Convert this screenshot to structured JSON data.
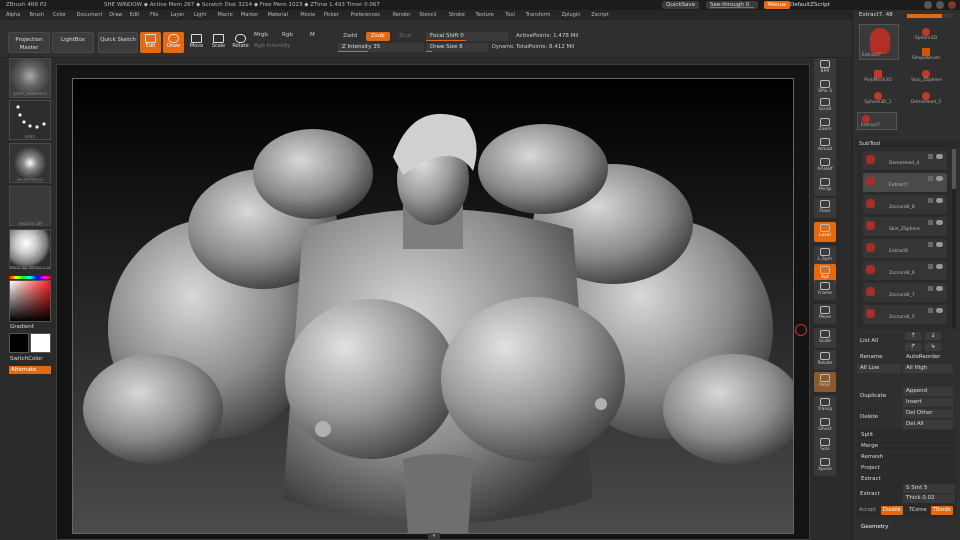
{
  "titlebar": {
    "app": "ZBrush 4R6 P2",
    "status": "SHE WINDOW  ◆ Active Mem 267 ◆ Scratch Disk 3214 ◆ Free Mem 1023 ◆ ZTime 1.493 Timer 0.067",
    "quicksave": "QuickSave",
    "see_through": "See-through  0",
    "menus": "Menus",
    "default_script": "DefaultZScript"
  },
  "menus": [
    "Alpha",
    "Brush",
    "Color",
    "Document",
    "Draw",
    "Edit",
    "File",
    "Layer",
    "Light",
    "Macro",
    "Marker",
    "Material",
    "Movie",
    "Picker",
    "Preferences",
    "Render",
    "Stencil",
    "Stroke",
    "Texture",
    "Tool",
    "Transform",
    "Zplugin",
    "Zscript"
  ],
  "toolbar": {
    "projection_master": "Projection Master",
    "lightbox": "LightBox",
    "quick_sketch": "Quick Sketch",
    "edit": "Edit",
    "draw": "Draw",
    "move": "Move",
    "scale": "Scale",
    "rotate": "Rotate",
    "mrgb": "Mrgb",
    "rgb": "Rgb",
    "m": "M",
    "rgb_intensity": "Rgb Intensity",
    "zadd": "Zadd",
    "zsub": "Zsub",
    "zcut": "Zcut",
    "z_intensity": "Z Intensity 35",
    "z_intensity_value": 35,
    "focal_shift": "Focal Shift 0",
    "draw_size": "Draw Size 8",
    "draw_size_value": 8,
    "dynamic": "Dynamic",
    "active_points": "ActivePoints: 1.478 Mil",
    "total_points": "TotalPoints: 8.412 Mil"
  },
  "left_shelf": {
    "brush": "Dam_Standard",
    "stroke": "Dots",
    "alpha": "BrushAlpha",
    "texture": "Texture Off",
    "material": "MatCap White Cav",
    "gradient": "Gradient",
    "switch_color": "SwitchColor",
    "alternate": "Alternate"
  },
  "right_shelf": [
    "BPR",
    "SPix 3",
    "Scroll",
    "Zoom",
    "Actual",
    "AAHalf",
    "Persp",
    "Floor",
    "Local",
    "L.Sym",
    "Xyz",
    "Frame",
    "Move",
    "Scale",
    "Rotate",
    "PolyF",
    "Transp",
    "Ghost",
    "Solo",
    "Xpose"
  ],
  "right_panel": {
    "tool_title": "Extract7. 48",
    "tool_slider_value": 0.75,
    "tools": [
      "Extract7",
      "Sphere3D",
      "SimpleBrush",
      "PolyMesh3D",
      "Skin_ZSphere",
      "Sphere3D_1",
      "DemoHead_5",
      "Extract7"
    ],
    "subtool_header": "SubTool",
    "subtools": [
      "DemoHead_4",
      "Extract7",
      "Zsccord4_8",
      "Skin_ZSphere",
      "Extract6",
      "Zsccord4_6",
      "Zsccord4_7",
      "Zsccord4_5"
    ],
    "list_all": "List All",
    "rename": "Rename",
    "auto_reorder": "AutoReorder",
    "all_low": "All Low",
    "all_high": "All High",
    "duplicate": "Duplicate",
    "append": "Append",
    "insert": "Insert",
    "delete": "Delete",
    "del_other": "Del Other",
    "del_all": "Del All",
    "split": "Split",
    "merge": "Merge",
    "remesh": "Remesh",
    "project": "Project",
    "extract_section": "Extract",
    "extract_btn": "Extract",
    "s_smt": "S Smt 5",
    "thick": "Thick 0.02",
    "accept": "Accept",
    "double": "Double",
    "tcorne": "TCorne",
    "tborde": "TBorde",
    "geometry": "Geometry"
  },
  "colors": {
    "accent": "#e36a12",
    "background": "#2b2b2b"
  }
}
